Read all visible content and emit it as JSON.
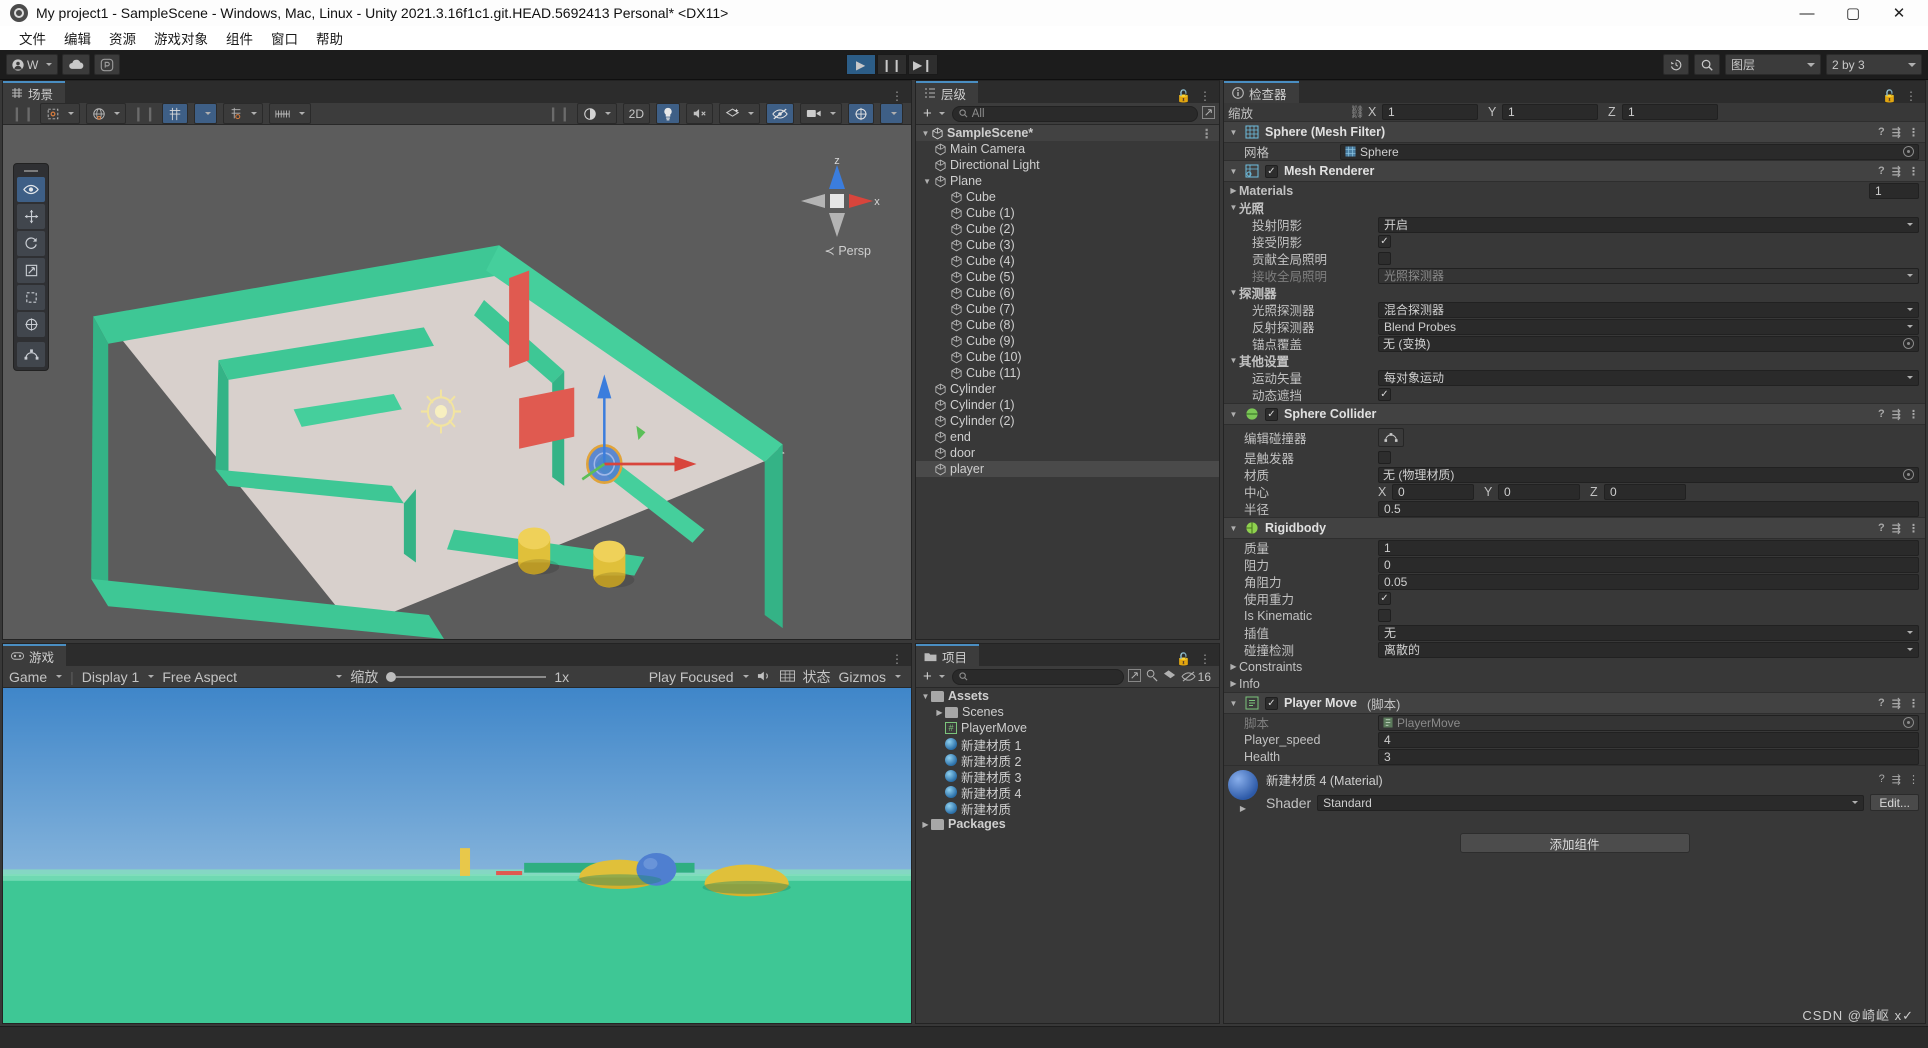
{
  "window": {
    "title": "My project1 - SampleScene - Windows, Mac, Linux - Unity 2021.3.16f1c1.git.HEAD.5692413 Personal* <DX11>",
    "minimize": "—",
    "maximize": "▢",
    "close": "✕"
  },
  "menu": {
    "items": [
      "文件",
      "编辑",
      "资源",
      "游戏对象",
      "组件",
      "窗口",
      "帮助"
    ]
  },
  "toolbar": {
    "account_label": "W",
    "cloud_icon": "cloud-icon",
    "collab_icon": "collab-icon",
    "play": "▶",
    "pause": "❙❙",
    "step": "▶❙",
    "play_active": true,
    "history_icon": "history-icon",
    "search_icon": "search-icon",
    "layers_label": "图层",
    "layout_label": "2 by 3"
  },
  "scene_panel": {
    "tab": "场景",
    "tools": [
      "hand-icon",
      "move-icon",
      "rotate-icon",
      "scale-icon",
      "rect-icon",
      "transform-icon",
      "custom-icon"
    ],
    "active_tool": 0,
    "toolbar_left": [
      "pivot-icon",
      "global-icon",
      "grid-snap-icon",
      "snap-increment-icon",
      "ruler-icon"
    ],
    "toolbar_right": [
      "shading-icon",
      "2D",
      "light-icon",
      "audio-icon",
      "fx-icon",
      "hidden-icon",
      "camera-icon",
      "gizmos-icon"
    ],
    "twod_label": "2D",
    "gizmo": {
      "z": "z",
      "x": "x",
      "mode": "Persp"
    }
  },
  "game_panel": {
    "tab": "游戏",
    "display_mode": "Game",
    "display": "Display 1",
    "aspect": "Free Aspect",
    "scale_label": "缩放",
    "scale_value": "1x",
    "play_focused": "Play Focused",
    "mute_icon": "mute-icon",
    "stats_grid_icon": "grid-icon",
    "stats": "状态",
    "gizmos": "Gizmos"
  },
  "hierarchy": {
    "tab": "层级",
    "add_label": "+",
    "search_placeholder": "All",
    "scene_name": "SampleScene*",
    "items": [
      {
        "label": "Main Camera",
        "depth": 2
      },
      {
        "label": "Directional Light",
        "depth": 2
      },
      {
        "label": "Plane",
        "depth": 2,
        "expandable": true
      },
      {
        "label": "Cube",
        "depth": 3
      },
      {
        "label": "Cube (1)",
        "depth": 3
      },
      {
        "label": "Cube (2)",
        "depth": 3
      },
      {
        "label": "Cube (3)",
        "depth": 3
      },
      {
        "label": "Cube (4)",
        "depth": 3
      },
      {
        "label": "Cube (5)",
        "depth": 3
      },
      {
        "label": "Cube (6)",
        "depth": 3
      },
      {
        "label": "Cube (7)",
        "depth": 3
      },
      {
        "label": "Cube (8)",
        "depth": 3
      },
      {
        "label": "Cube (9)",
        "depth": 3
      },
      {
        "label": "Cube (10)",
        "depth": 3
      },
      {
        "label": "Cube (11)",
        "depth": 3
      },
      {
        "label": "Cylinder",
        "depth": 2
      },
      {
        "label": "Cylinder (1)",
        "depth": 2
      },
      {
        "label": "Cylinder (2)",
        "depth": 2
      },
      {
        "label": "end",
        "depth": 2
      },
      {
        "label": "door",
        "depth": 2
      },
      {
        "label": "player",
        "depth": 2,
        "selected": true
      }
    ]
  },
  "project": {
    "tab": "项目",
    "add_label": "+",
    "search_placeholder": "",
    "hidden_count": "16",
    "items": [
      {
        "label": "Assets",
        "depth": 0,
        "type": "folder",
        "expanded": true
      },
      {
        "label": "Scenes",
        "depth": 1,
        "type": "folder",
        "collapsed": true
      },
      {
        "label": "PlayerMove",
        "depth": 1,
        "type": "script"
      },
      {
        "label": "新建材质 1",
        "depth": 1,
        "type": "material"
      },
      {
        "label": "新建材质 2",
        "depth": 1,
        "type": "material"
      },
      {
        "label": "新建材质 3",
        "depth": 1,
        "type": "material"
      },
      {
        "label": "新建材质 4",
        "depth": 1,
        "type": "material"
      },
      {
        "label": "新建材质",
        "depth": 1,
        "type": "material"
      },
      {
        "label": "Packages",
        "depth": 0,
        "type": "folder",
        "collapsed": true
      }
    ]
  },
  "inspector": {
    "tab": "检查器",
    "scale_label": "缩放",
    "scale": {
      "x_label": "X",
      "x": "1",
      "y_label": "Y",
      "y": "1",
      "z_label": "Z",
      "z": "1"
    },
    "mesh_filter": {
      "title": "Sphere (Mesh Filter)",
      "mesh_label": "网格",
      "mesh_value": "Sphere"
    },
    "mesh_renderer": {
      "title": "Mesh Renderer",
      "materials_label": "Materials",
      "materials_count": "1",
      "lighting_label": "光照",
      "cast_shadows_label": "投射阴影",
      "cast_shadows_value": "开启",
      "receive_shadows_label": "接受阴影",
      "receive_shadows_checked": true,
      "contribute_gi_label": "贡献全局照明",
      "contribute_gi_checked": false,
      "receive_gi_label": "接收全局照明",
      "receive_gi_value": "光照探测器",
      "probes_label": "探测器",
      "light_probes_label": "光照探测器",
      "light_probes_value": "混合探测器",
      "reflection_probes_label": "反射探测器",
      "reflection_probes_value": "Blend Probes",
      "anchor_override_label": "锚点覆盖",
      "anchor_override_value": "无 (变换)",
      "other_label": "其他设置",
      "motion_vectors_label": "运动矢量",
      "motion_vectors_value": "每对象运动",
      "dynamic_occlusion_label": "动态遮挡",
      "dynamic_occlusion_checked": true
    },
    "sphere_collider": {
      "title": "Sphere Collider",
      "enabled": true,
      "edit_collider_label": "编辑碰撞器",
      "is_trigger_label": "是触发器",
      "is_trigger_checked": false,
      "material_label": "材质",
      "material_value": "无 (物理材质)",
      "center_label": "中心",
      "center": {
        "x_label": "X",
        "x": "0",
        "y_label": "Y",
        "y": "0",
        "z_label": "Z",
        "z": "0"
      },
      "radius_label": "半径",
      "radius_value": "0.5"
    },
    "rigidbody": {
      "title": "Rigidbody",
      "mass_label": "质量",
      "mass_value": "1",
      "drag_label": "阻力",
      "drag_value": "0",
      "angular_drag_label": "角阻力",
      "angular_drag_value": "0.05",
      "use_gravity_label": "使用重力",
      "use_gravity_checked": true,
      "is_kinematic_label": "Is Kinematic",
      "is_kinematic_checked": false,
      "interpolate_label": "插值",
      "interpolate_value": "无",
      "collision_detection_label": "碰撞检测",
      "collision_detection_value": "离散的",
      "constraints_label": "Constraints",
      "info_label": "Info"
    },
    "player_move": {
      "title": "Player Move",
      "title_suffix": "(脚本)",
      "enabled": true,
      "script_label": "脚本",
      "script_value": "PlayerMove",
      "speed_label": "Player_speed",
      "speed_value": "4",
      "health_label": "Health",
      "health_value": "3"
    },
    "material_preview": {
      "title": "新建材质 4 (Material)",
      "shader_label": "Shader",
      "shader_value": "Standard",
      "edit_label": "Edit..."
    },
    "add_component": "添加组件"
  },
  "watermark": "CSDN @崎岖 x✓",
  "colors": {
    "accent": "#4a8ec2",
    "play_active": "#2c5d87",
    "panel_bg": "#383838",
    "header_bg": "#3c3c3c",
    "field_bg": "#2a2a2a",
    "scene_ground": "#3ec795"
  }
}
